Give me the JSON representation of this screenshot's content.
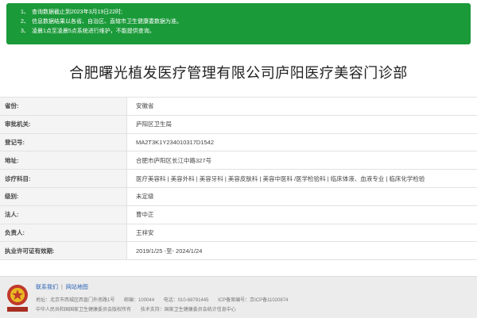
{
  "notice": {
    "lines": [
      {
        "num": "1、",
        "text": "查询数据截止到2023年3月19日22时;"
      },
      {
        "num": "2、",
        "text": "信息数据结果以各省、自治区、直辖市卫生健康委数据为准。"
      },
      {
        "num": "3、",
        "text": "凌晨1点至凌晨5点系统进行维护，不能提供查询。"
      }
    ]
  },
  "title": "合肥曙光植发医疗管理有限公司庐阳医疗美容门诊部",
  "rows": [
    {
      "label": "省份:",
      "value": "安徽省"
    },
    {
      "label": "审批机关:",
      "value": "庐阳区卫生局"
    },
    {
      "label": "登记号:",
      "value": "MA2T3K1Y234010317D1542"
    },
    {
      "label": "地址:",
      "value": "合肥市庐阳区长江中路327号"
    },
    {
      "label": "诊疗科目:",
      "value": "医疗美容科 | 美容外科 | 美容牙科 | 美容皮肤科 | 美容中医科 /医学检验科 | 临床体液、血液专业 | 临床化学检验"
    },
    {
      "label": "级别:",
      "value": "未定级"
    },
    {
      "label": "法人:",
      "value": "曹中正"
    },
    {
      "label": "负责人:",
      "value": "王祥安"
    },
    {
      "label": "执业许可证有效期:",
      "value": "2019/1/25 -至- 2024/1/24"
    }
  ],
  "footer": {
    "links": [
      "联系我们",
      "网站地图"
    ],
    "line1": [
      "地址：北京市西城区西直门外南路1号",
      "邮编：100044",
      "电话：010-68791445",
      "ICP备案编号：京ICP备11020874"
    ],
    "line2": [
      "中华人民共和国国家卫生健康委员会版权所有",
      "技术支持：国家卫生健康委员会统计信息中心"
    ],
    "emblem_color": "#c0392b"
  }
}
